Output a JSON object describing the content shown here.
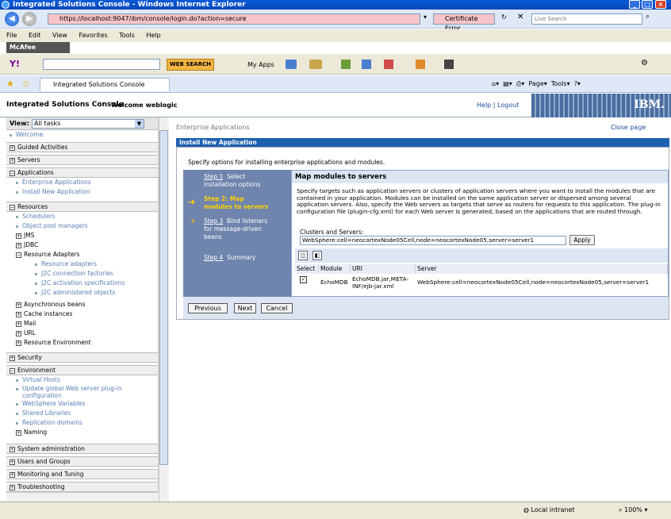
{
  "window": {
    "title": "Integrated Solutions Console - Windows Internet Explorer"
  },
  "address": {
    "url": "https://localhost:9047/ibm/console/login.do?action=secure",
    "cert_error": "Certificate Error",
    "live_search_placeholder": "Live Search"
  },
  "menu": [
    "File",
    "Edit",
    "View",
    "Favorites",
    "Tools",
    "Help"
  ],
  "mcafee": "McAfee",
  "yahoo": {
    "web_search": "WEB SEARCH",
    "my_apps": "My Apps"
  },
  "tab": {
    "label": "Integrated Solutions Console",
    "page": "Page",
    "tools": "Tools"
  },
  "header": {
    "title": "Integrated Solutions Console",
    "welcome": "Welcome weblogic",
    "help": "Help",
    "logout": "Logout",
    "logo": "IBM."
  },
  "sidebar": {
    "view_label": "View:",
    "view_value": "All tasks",
    "welcome": "Welcome",
    "guided": "Guided Activities",
    "servers": "Servers",
    "applications": "Applications",
    "app_items": [
      "Enterprise Applications",
      "Install New Application"
    ],
    "resources": "Resources",
    "res_items": [
      "Schedulers",
      "Object pool managers"
    ],
    "jms": "JMS",
    "jdbc": "JDBC",
    "resource_adapters": "Resource Adapters",
    "ra_items": [
      "Resource adapters",
      "J2C connection factories",
      "J2C activation specifications",
      "J2C administered objects"
    ],
    "res_more": [
      "Asynchronous beans",
      "Cache instances",
      "Mail",
      "URL",
      "Resource Environment"
    ],
    "security": "Security",
    "environment": "Environment",
    "env_items": [
      "Virtual Hosts",
      "Update global Web server plug-in configuration",
      "WebSphere Variables",
      "Shared Libraries",
      "Replication domains"
    ],
    "naming": "Naming",
    "sections": [
      "System administration",
      "Users and Groups",
      "Monitoring and Tuning",
      "Troubleshooting"
    ]
  },
  "content": {
    "breadcrumb": "Enterprise Applications",
    "close_page": "Close page",
    "bar_title": "Install New Application",
    "specify": "Specify options for installing enterprise applications and modules.",
    "steps": {
      "s1_num": "Step 1",
      "s1_text": "Select installation options",
      "s2": "Step 2: Map modules to servers",
      "s3_num": "Step 3",
      "s3_text": "Bind listeners for message-driven beans",
      "s4_num": "Step 4",
      "s4_text": "Summary"
    },
    "map_title": "Map modules to servers",
    "description": "Specify targets such as application servers or clusters of application servers where you want to install the modules that are contained in your application. Modules can be installed on the same application server or dispersed among several application servers. Also, specify the Web servers as targets that serve as routers for requests to this application. The plug-in configuration file (plugin-cfg.xml) for each Web server is generated, based on the applications that are routed through.",
    "clusters_label": "Clusters and Servers:",
    "clusters_value": "WebSphere:cell=neocortexNode05Cell,node=neocortexNode05,server=server1",
    "apply": "Apply",
    "table": {
      "headers": [
        "Select",
        "Module",
        "URI",
        "Server"
      ],
      "row": {
        "module": "EchoMDB",
        "uri": "EchoMDB.jar,META-INF/ejb-jar.xml",
        "server": "WebSphere:cell=neocortexNode05Cell,node=neocortexNode05,server=server1"
      }
    },
    "buttons": {
      "previous": "Previous",
      "next": "Next",
      "cancel": "Cancel"
    }
  },
  "status": {
    "zone": "Local intranet",
    "zoom": "100%"
  }
}
